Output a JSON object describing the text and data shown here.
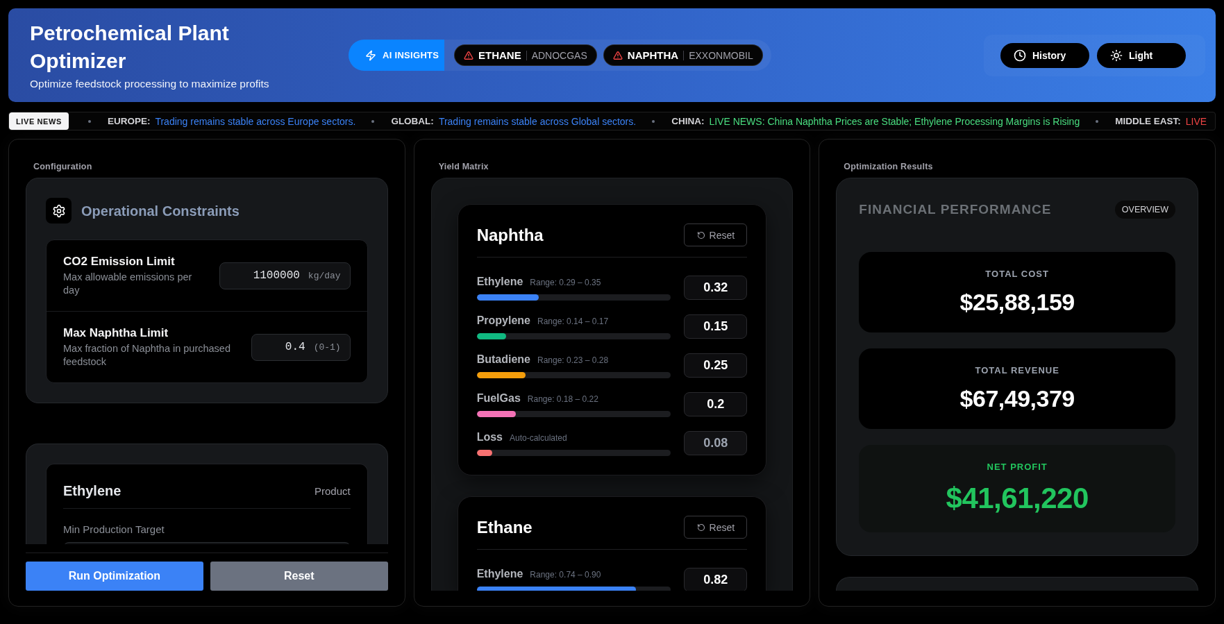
{
  "header": {
    "title": "Petrochemical Plant Optimizer",
    "subtitle": "Optimize feedstock processing to maximize profits",
    "insights_button": "AI INSIGHTS",
    "alerts": [
      {
        "feed": "ETHANE",
        "supplier": "ADNOCGAS"
      },
      {
        "feed": "NAPHTHA",
        "supplier": "EXXONMOBIL"
      }
    ],
    "actions": [
      {
        "kind": "history",
        "label": "History"
      },
      {
        "kind": "theme",
        "label": "Light"
      }
    ]
  },
  "ticker": {
    "badge": "LIVE NEWS",
    "items": [
      {
        "region": "EUROPE:",
        "text": "Trading remains stable across Europe sectors.",
        "color": "#3b82f6"
      },
      {
        "region": "GLOBAL:",
        "text": "Trading remains stable across Global sectors.",
        "color": "#3b82f6"
      },
      {
        "region": "CHINA:",
        "text": "LIVE NEWS: China Naphtha Prices are Stable; Ethylene Processing Margins is Rising",
        "color": "#4ade80"
      },
      {
        "region": "MIDDLE EAST:",
        "text": "LIVE",
        "color": "#ef4444"
      }
    ]
  },
  "configuration": {
    "heading": "Configuration",
    "constraints": {
      "title": "Operational Constraints",
      "fields": [
        {
          "label": "CO2 Emission Limit",
          "description": "Max allowable emissions per day",
          "value": "1100000",
          "unit": "kg/day"
        },
        {
          "label": "Max Naphtha Limit",
          "description": "Max fraction of Naphtha in purchased feedstock",
          "value": "0.4",
          "unit": "(0-1)"
        }
      ]
    },
    "products": [
      {
        "name": "Ethylene",
        "tag": "Product",
        "target_label": "Min Production Target"
      }
    ],
    "buttons": [
      {
        "kind": "run",
        "label": "Run Optimization"
      },
      {
        "kind": "reset",
        "label": "Reset"
      }
    ]
  },
  "yield_matrix": {
    "heading": "Yield Matrix",
    "feeds": [
      {
        "name": "Naphtha",
        "reset_label": "Reset",
        "yields": [
          {
            "product": "Ethylene",
            "hint": "Range: 0.29 – 0.35",
            "value": "0.32",
            "level": 0.32,
            "color": "#3b82f6",
            "disabled": false
          },
          {
            "product": "Propylene",
            "hint": "Range: 0.14 – 0.17",
            "value": "0.15",
            "level": 0.15,
            "color": "#10b981",
            "disabled": false
          },
          {
            "product": "Butadiene",
            "hint": "Range: 0.23 – 0.28",
            "value": "0.25",
            "level": 0.25,
            "color": "#f59e0b",
            "disabled": false
          },
          {
            "product": "FuelGas",
            "hint": "Range: 0.18 – 0.22",
            "value": "0.2",
            "level": 0.2,
            "color": "#f472b6",
            "disabled": false
          },
          {
            "product": "Loss",
            "hint": "Auto-calculated",
            "value": "0.08",
            "level": 0.08,
            "color": "#f87171",
            "disabled": true
          }
        ]
      },
      {
        "name": "Ethane",
        "reset_label": "Reset",
        "yields": [
          {
            "product": "Ethylene",
            "hint": "Range: 0.74 – 0.90",
            "value": "0.82",
            "level": 0.82,
            "color": "#3b82f6",
            "disabled": false
          }
        ]
      }
    ]
  },
  "results": {
    "heading": "Optimization Results",
    "title": "FINANCIAL PERFORMANCE",
    "badge": "OVERVIEW",
    "metrics": [
      {
        "kind": "plain",
        "label": "TOTAL COST",
        "value": "$25,88,159"
      },
      {
        "kind": "plain",
        "label": "TOTAL REVENUE",
        "value": "$67,49,379"
      },
      {
        "kind": "highlight",
        "label": "NET PROFIT",
        "value": "$41,61,220"
      }
    ]
  }
}
